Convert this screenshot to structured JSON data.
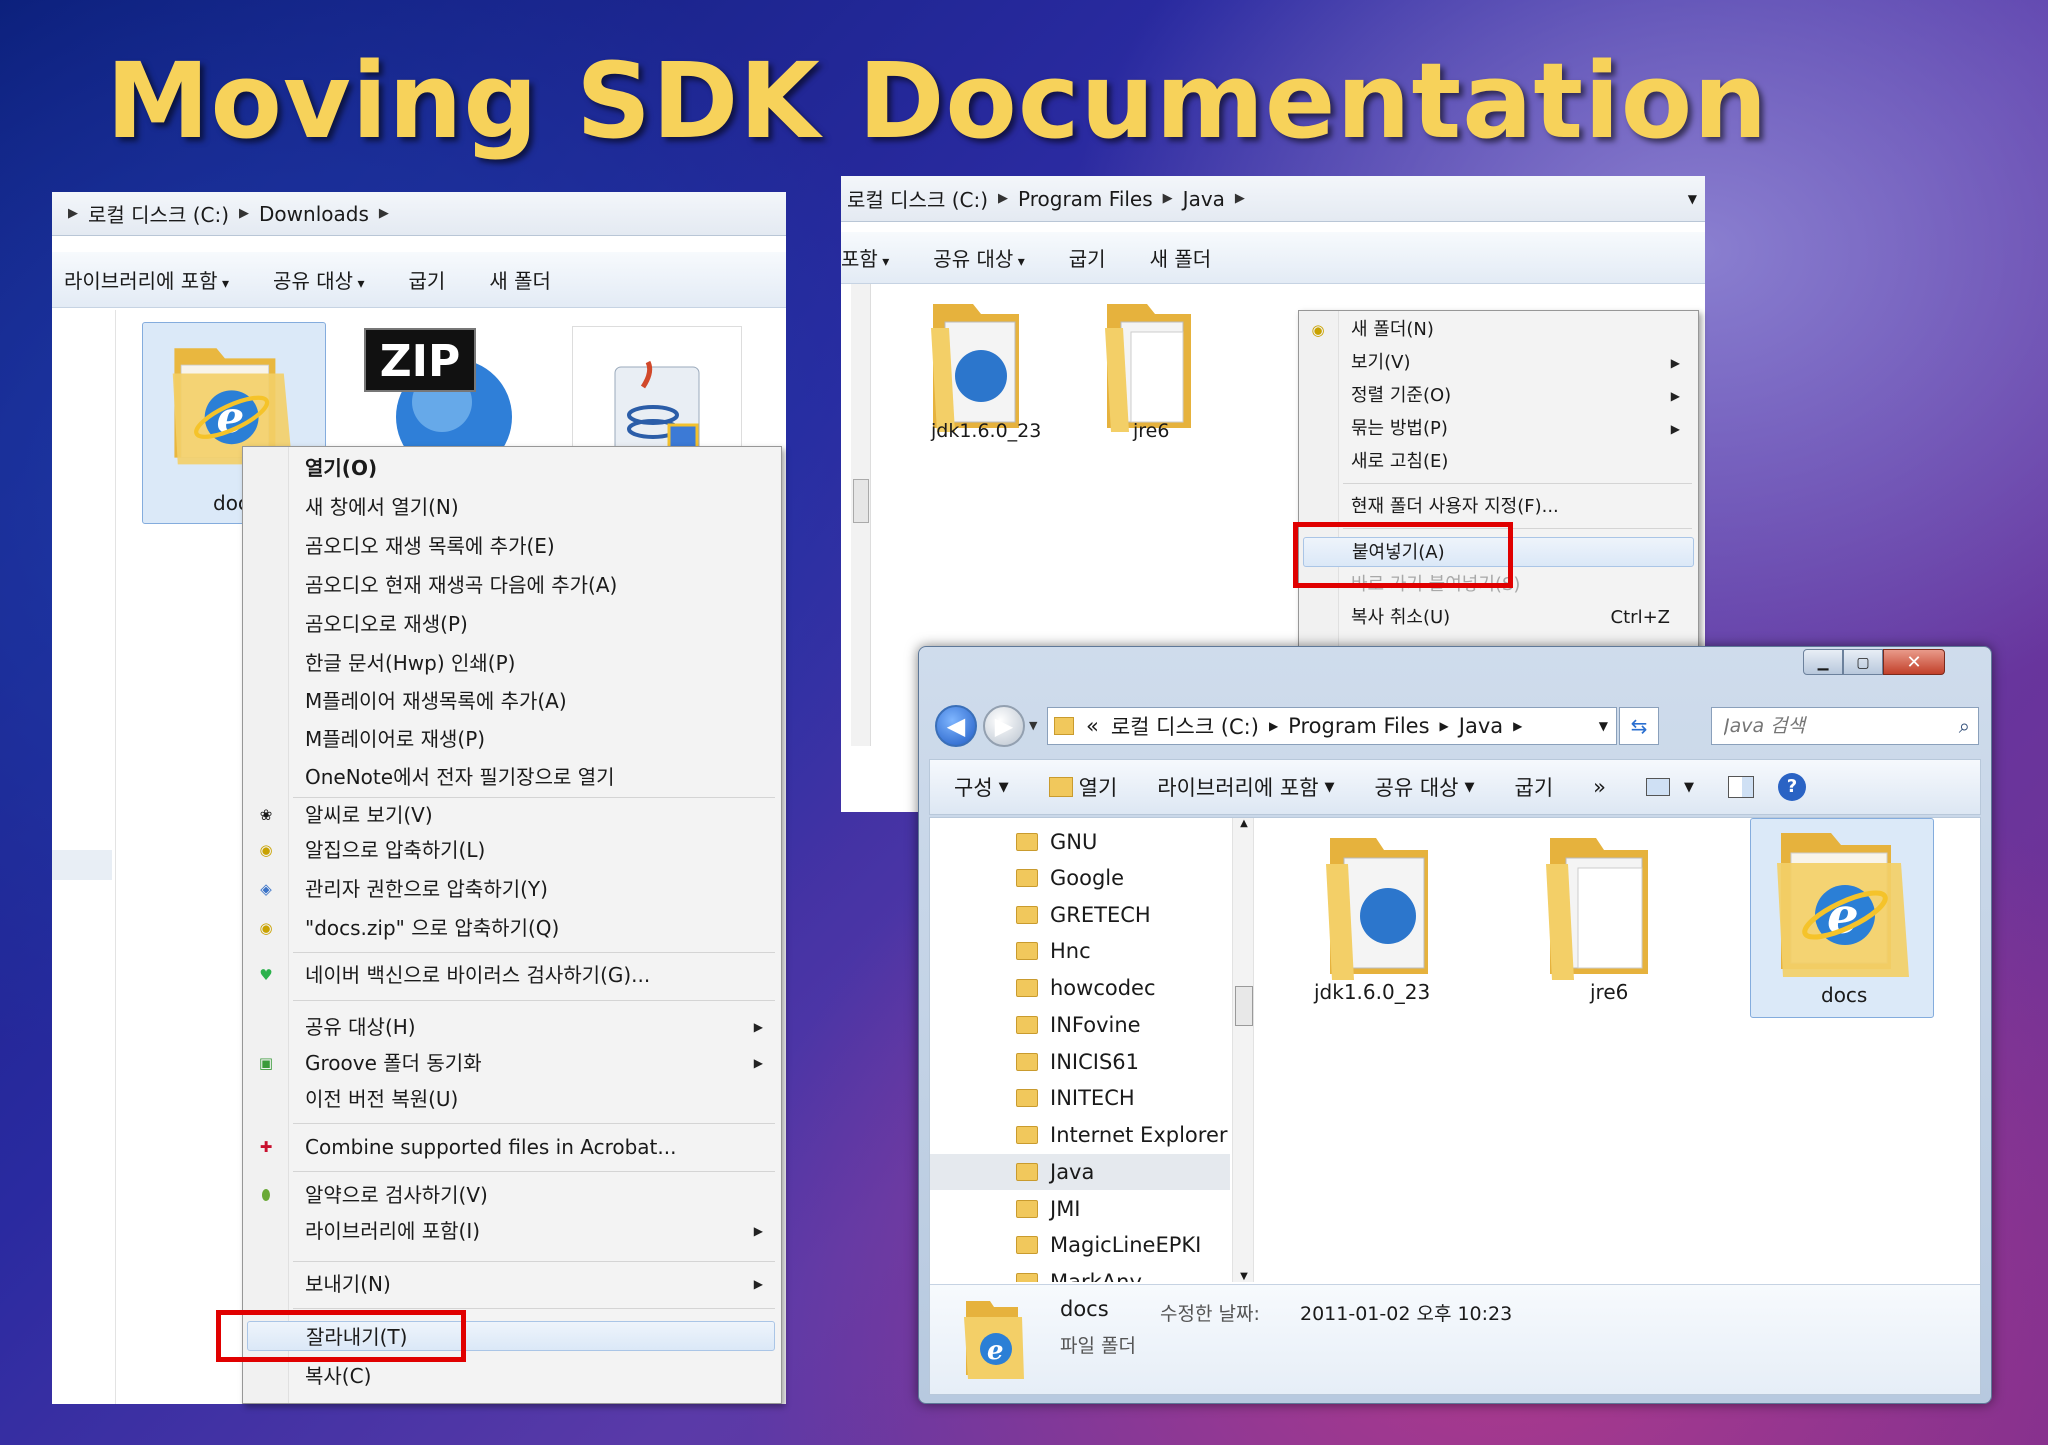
{
  "slide_title": "Moving SDK Documentation",
  "left_window": {
    "breadcrumb": [
      "로컬 디스크 (C:)",
      "Downloads"
    ],
    "toolbar": [
      "라이브러리에 포함",
      "공유 대상",
      "굽기",
      "새 폴더"
    ],
    "files": [
      {
        "label": "doc",
        "type": "ie-folder"
      },
      {
        "label": "",
        "type": "zip",
        "badge": "ZIP"
      },
      {
        "label": "",
        "type": "java-installer"
      }
    ],
    "context_menu": [
      {
        "label": "열기(O)",
        "bold": true
      },
      {
        "label": "새 창에서 열기(N)"
      },
      {
        "label": "곰오디오 재생 목록에 추가(E)"
      },
      {
        "label": "곰오디오 현재 재생곡 다음에 추가(A)"
      },
      {
        "label": "곰오디오로 재생(P)"
      },
      {
        "label": "한글 문서(Hwp) 인쇄(P)"
      },
      {
        "label": "M플레이어 재생목록에 추가(A)"
      },
      {
        "label": "M플레이어로 재생(P)"
      },
      {
        "label": "OneNote에서 전자 필기장으로 열기"
      },
      {
        "label": "알씨로 보기(V)",
        "icon": "alsee-icon"
      },
      {
        "label": "알집으로 압축하기(L)",
        "icon": "alzip-icon"
      },
      {
        "label": "관리자 권한으로 압축하기(Y)",
        "icon": "alzip-admin-icon"
      },
      {
        "label": "\"docs.zip\" 으로 압축하기(Q)",
        "icon": "alzip-icon"
      },
      {
        "label": "네이버 백신으로 바이러스 검사하기(G)...",
        "icon": "naver-vaccine-icon"
      },
      {
        "label": "공유 대상(H)",
        "submenu": true
      },
      {
        "label": "Groove 폴더 동기화",
        "submenu": true,
        "icon": "groove-icon"
      },
      {
        "label": "이전 버전 복원(U)"
      },
      {
        "label": "Combine supported files in Acrobat...",
        "icon": "acrobat-icon"
      },
      {
        "label": "알약으로 검사하기(V)",
        "icon": "alyac-icon"
      },
      {
        "label": "라이브러리에 포함(I)",
        "submenu": true
      },
      {
        "label": "보내기(N)",
        "submenu": true
      },
      {
        "label": "잘라내기(T)",
        "highlighted": true
      },
      {
        "label": "복사(C)"
      }
    ]
  },
  "top_right_window": {
    "breadcrumb": [
      "로컬 디스크 (C:)",
      "Program Files",
      "Java"
    ],
    "toolbar": [
      "포함",
      "공유 대상",
      "굽기",
      "새 폴더"
    ],
    "files": [
      {
        "label": "jdk1.6.0_23"
      },
      {
        "label": "jre6"
      }
    ],
    "context_menu": [
      {
        "label": "새 폴더(N)",
        "icon": "new-folder-icon"
      },
      {
        "label": "보기(V)",
        "submenu": true
      },
      {
        "label": "정렬 기준(O)",
        "submenu": true
      },
      {
        "label": "묶는 방법(P)",
        "submenu": true
      },
      {
        "label": "새로 고침(E)"
      },
      {
        "label": "현재 폴더 사용자 지정(F)..."
      },
      {
        "label": "붙여넣기(A)",
        "highlighted": true
      },
      {
        "label": "바로 가기 붙여넣기(S)",
        "disabled": true
      },
      {
        "label": "복사 취소(U)",
        "shortcut": "Ctrl+Z"
      }
    ]
  },
  "front_window": {
    "breadcrumb_prefix": "«",
    "breadcrumb": [
      "로컬 디스크 (C:)",
      "Program Files",
      "Java"
    ],
    "search_placeholder": "Java 검색",
    "toolbar": [
      "구성",
      "열기",
      "라이브러리에 포함",
      "공유 대상",
      "굽기",
      "»"
    ],
    "nav_items": [
      "GNU",
      "Google",
      "GRETECH",
      "Hnc",
      "howcodec",
      "INFovine",
      "INICIS61",
      "INITECH",
      "Internet Explorer",
      "Java",
      "JMI",
      "MagicLineEPKI",
      "MarkAny"
    ],
    "selected_nav": "Java",
    "files": [
      {
        "label": "jdk1.6.0_23"
      },
      {
        "label": "jre6"
      },
      {
        "label": "docs",
        "selected": true
      }
    ],
    "details": {
      "name": "docs",
      "modified_label": "수정한 날짜:",
      "modified_value": "2011-01-02 오후 10:23",
      "type": "파일 폴더"
    }
  }
}
